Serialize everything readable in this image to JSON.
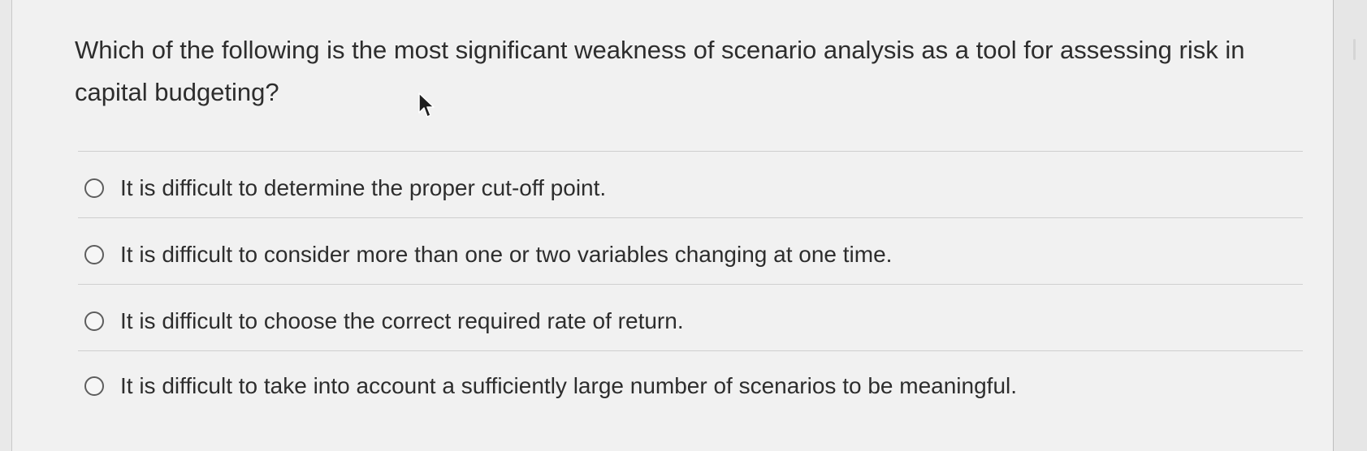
{
  "question": {
    "text": "Which of the following is the most significant weakness of scenario analysis as a tool for assessing risk in capital budgeting?"
  },
  "options": [
    {
      "label": "It is difficult to determine the proper cut-off point.",
      "selected": false
    },
    {
      "label": "It is difficult to consider more than one or two variables changing at one time.",
      "selected": false
    },
    {
      "label": "It is difficult to choose the correct required rate of return.",
      "selected": false
    },
    {
      "label": "It is difficult to take into account a sufficiently large number of scenarios to be meaningful.",
      "selected": false
    }
  ],
  "icons": {
    "cursor": "mouse-pointer-icon",
    "radio": "radio-button-icon"
  },
  "colors": {
    "background": "#f1f1f1",
    "text": "#2d2d2d",
    "divider": "#cfcfcf",
    "radio_border": "#5d5d5d"
  }
}
